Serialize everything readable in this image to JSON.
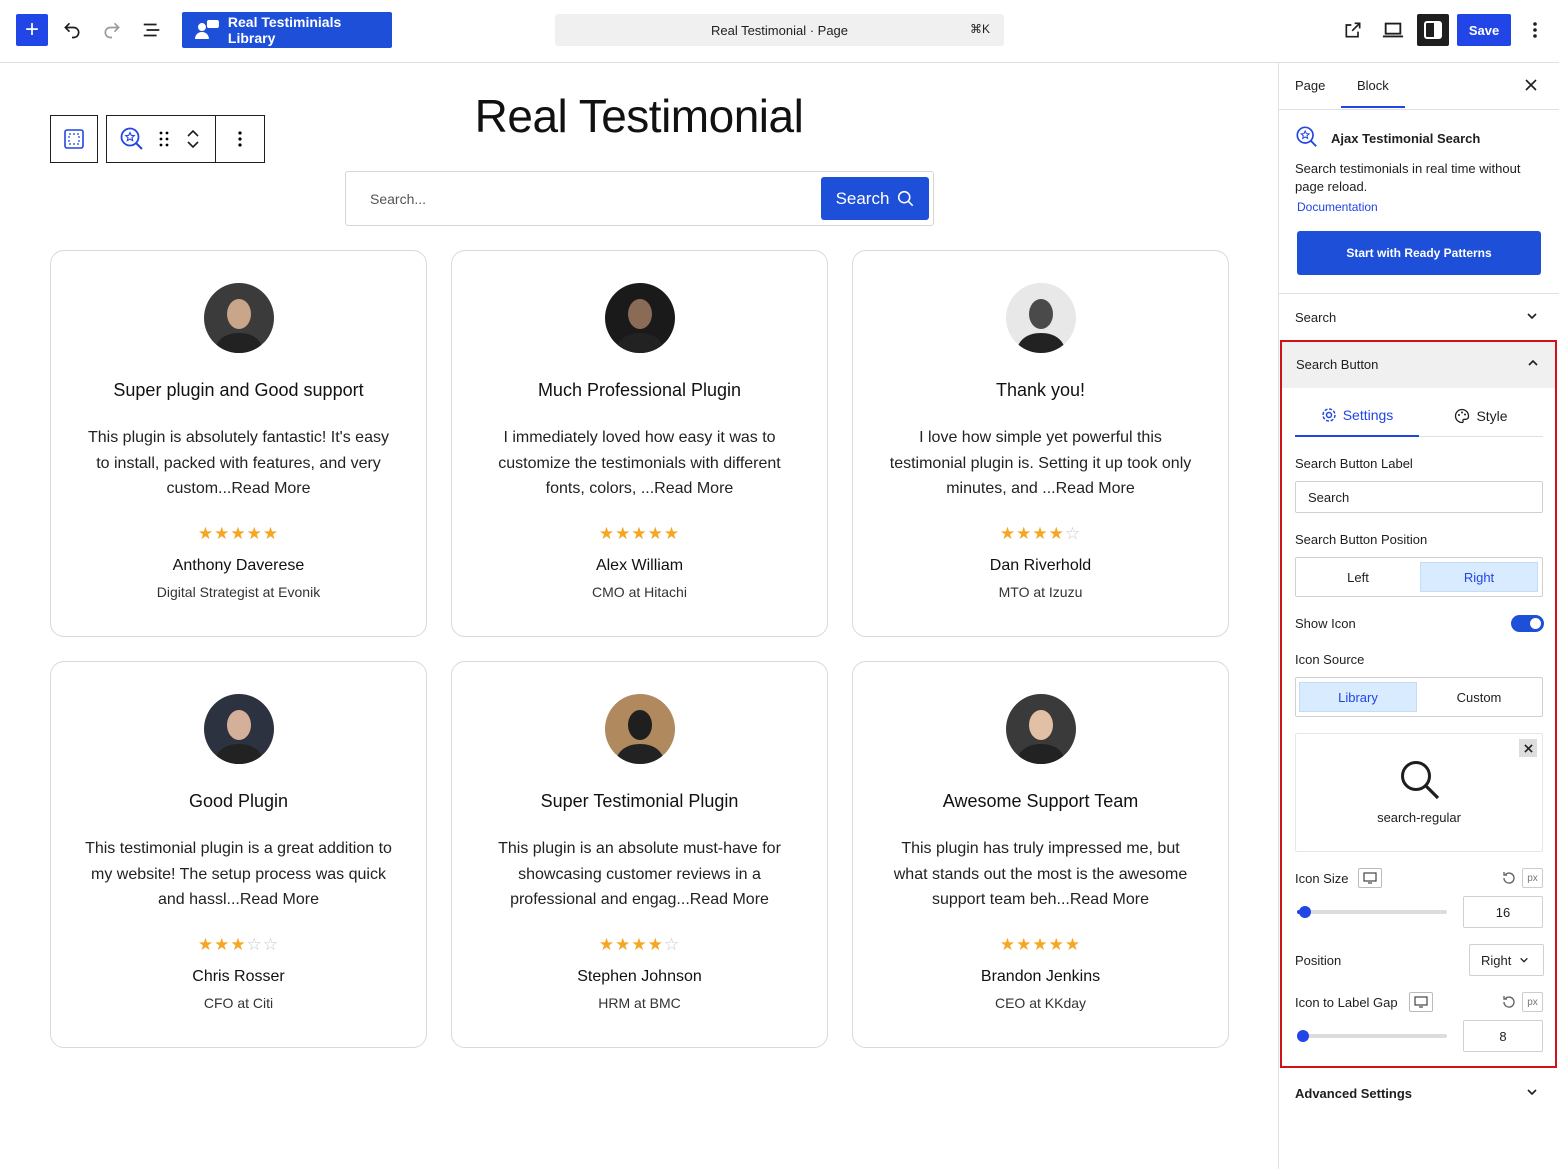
{
  "toolbar": {
    "library_label": "Real Testiminials Library",
    "command_title": "Real Testimonial · Page",
    "command_shortcut": "⌘K",
    "save_label": "Save"
  },
  "page": {
    "title": "Real Testimonial",
    "search_placeholder": "Search...",
    "search_button_label": "Search"
  },
  "testimonials": [
    {
      "title": "Super plugin and Good support",
      "text": "This plugin is absolutely fantastic! It's easy to install, packed with features, and very custom...Read More",
      "rating": 5,
      "name": "Anthony Daverese",
      "role": "Digital Strategist at Evonik"
    },
    {
      "title": "Much Professional Plugin",
      "text": "I immediately loved how easy it was to customize the testimonials with different fonts, colors, ...Read More",
      "rating": 5,
      "name": "Alex William",
      "role": "CMO at Hitachi"
    },
    {
      "title": "Thank you!",
      "text": "I love how simple yet powerful this testimonial plugin is. Setting it up took only minutes, and ...Read More",
      "rating": 4,
      "name": "Dan Riverhold",
      "role": "MTO at Izuzu"
    },
    {
      "title": "Good Plugin",
      "text": "This testimonial plugin is a great addition to my website! The setup process was quick and hassl...Read More",
      "rating": 3,
      "name": "Chris Rosser",
      "role": "CFO at Citi"
    },
    {
      "title": "Super Testimonial Plugin",
      "text": "This plugin is an absolute must-have for showcasing customer reviews in a professional and engag...Read More",
      "rating": 4,
      "name": "Stephen Johnson",
      "role": "HRM at BMC"
    },
    {
      "title": "Awesome Support Team",
      "text": "This plugin has truly impressed me, but what stands out the most is the awesome support team beh...Read More",
      "rating": 5,
      "name": "Brandon Jenkins",
      "role": "CEO at KKday"
    }
  ],
  "sidebar": {
    "tab_page": "Page",
    "tab_block": "Block",
    "block_name": "Ajax Testimonial Search",
    "block_description": "Search testimonials in real time without page reload.",
    "documentation_link": "Documentation",
    "ready_patterns_button": "Start with Ready Patterns",
    "panel_search": "Search",
    "panel_search_button": "Search Button",
    "tab_settings": "Settings",
    "tab_style": "Style",
    "button_label_heading": "Search Button Label",
    "button_label_value": "Search",
    "button_position_heading": "Search Button Position",
    "position_left": "Left",
    "position_right": "Right",
    "show_icon_label": "Show Icon",
    "show_icon_on": true,
    "icon_source_heading": "Icon Source",
    "source_library": "Library",
    "source_custom": "Custom",
    "icon_name": "search-regular",
    "icon_size_label": "Icon Size",
    "icon_size_value": "16",
    "icon_size_slider_fraction": 0.05,
    "position_label": "Position",
    "position_value": "Right",
    "gap_label": "Icon to Label Gap",
    "gap_value": "8",
    "gap_slider_fraction": 0.0,
    "unit": "px",
    "panel_advanced": "Advanced Settings"
  },
  "colors": {
    "accent": "#2145e6",
    "button_blue": "#1d4fd8",
    "star": "#f5a623",
    "highlight_border": "#d0111a"
  }
}
